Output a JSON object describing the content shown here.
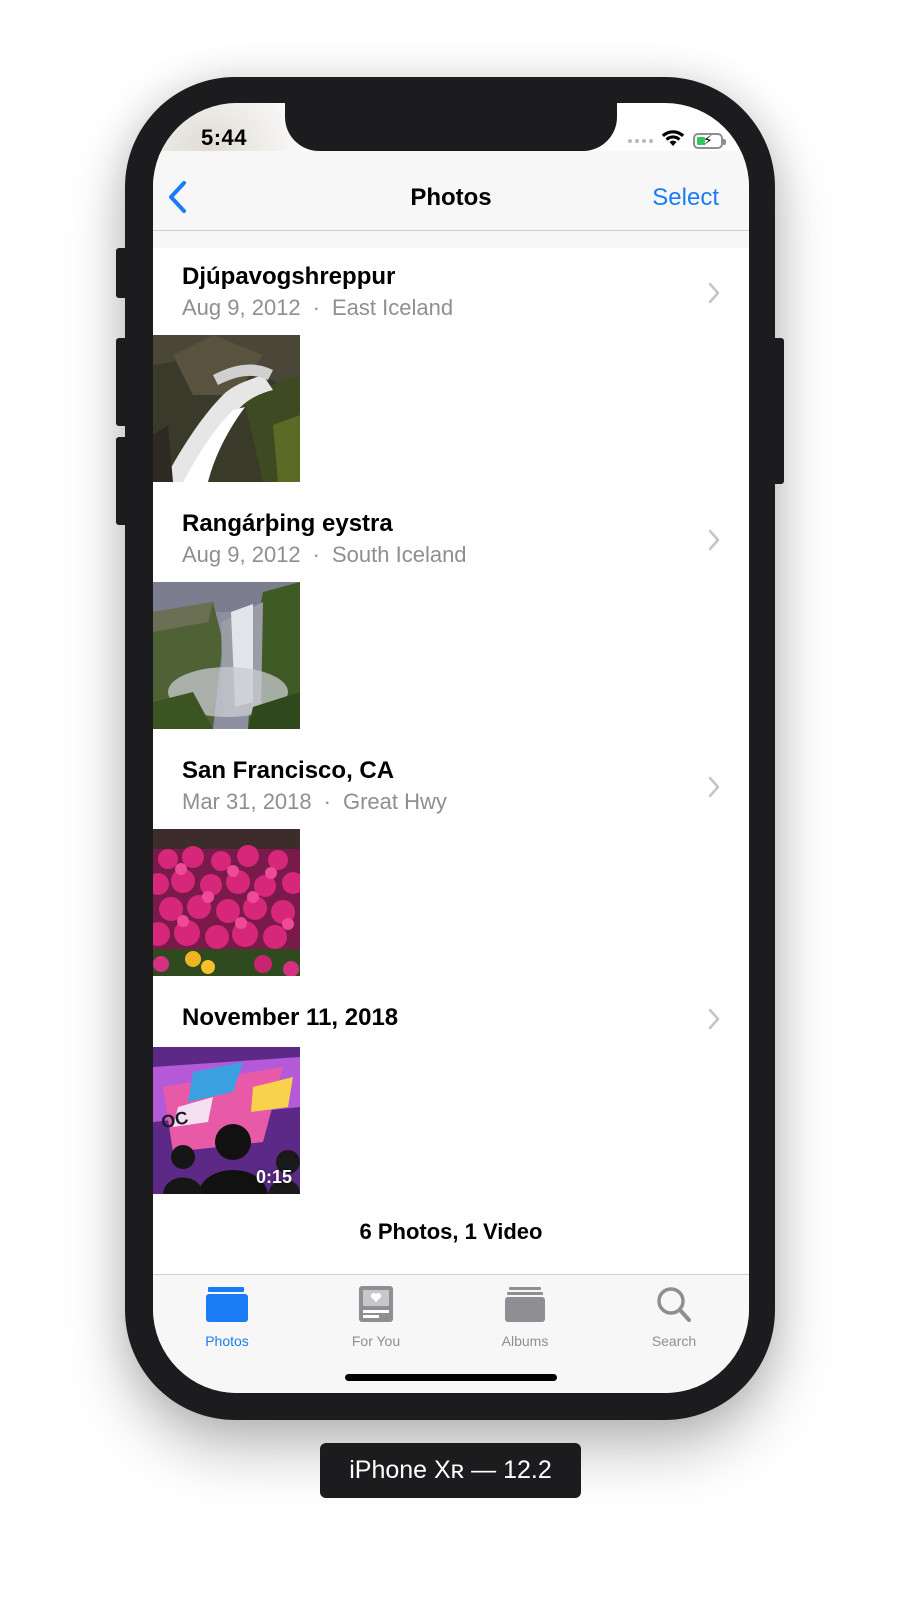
{
  "status_bar": {
    "time": "5:44"
  },
  "nav": {
    "back_icon": "chevron-left-icon",
    "title": "Photos",
    "select_label": "Select"
  },
  "sections": [
    {
      "title": "Djúpavogshreppur",
      "date": "Aug 9, 2012",
      "separator": "·",
      "location": "East Iceland",
      "thumbnail": "waterfall-closeup"
    },
    {
      "title": "Rangárþing eystra",
      "date": "Aug 9, 2012",
      "separator": "·",
      "location": "South Iceland",
      "thumbnail": "waterfall-cliff"
    },
    {
      "title": "San Francisco, CA",
      "date": "Mar 31, 2018",
      "separator": "·",
      "location": "Great Hwy",
      "thumbnail": "pink-flowers"
    },
    {
      "title": "November 11, 2018",
      "thumbnail": "concert-video",
      "duration": "0:15"
    }
  ],
  "summary": "6 Photos, 1 Video",
  "tabs": [
    {
      "label": "Photos",
      "icon": "photos-icon",
      "active": true
    },
    {
      "label": "For You",
      "icon": "for-you-icon",
      "active": false
    },
    {
      "label": "Albums",
      "icon": "albums-icon",
      "active": false
    },
    {
      "label": "Search",
      "icon": "search-icon",
      "active": false
    }
  ],
  "device_label": "iPhone Xʀ — 12.2",
  "colors": {
    "accent": "#1a7cf5",
    "secondary_text": "#8e8e93",
    "device_frame": "#1c1c1e"
  }
}
